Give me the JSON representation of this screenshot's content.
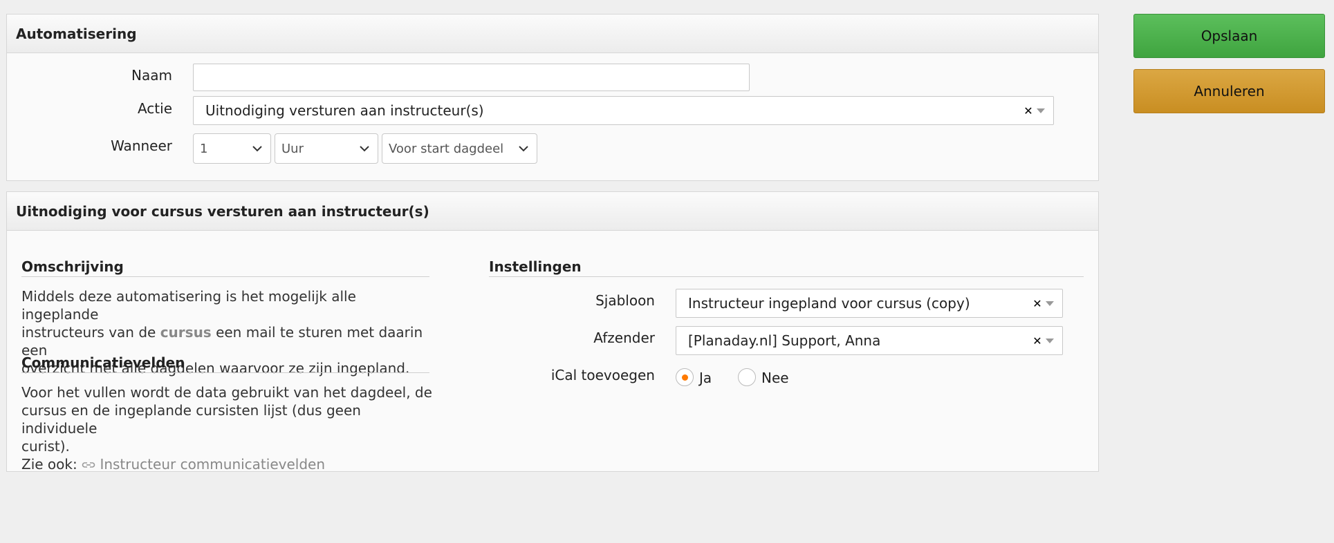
{
  "automation_panel": {
    "title": "Automatisering",
    "naam_label": "Naam",
    "naam_value": "",
    "actie_label": "Actie",
    "actie_value": "Uitnodiging versturen aan instructeur(s)",
    "wanneer_label": "Wanneer",
    "wanneer_amount": "1",
    "wanneer_unit": "Uur",
    "wanneer_relative": "Voor start dagdeel"
  },
  "detail_panel": {
    "title": "Uitnodiging voor cursus versturen aan instructeur(s)",
    "omschrijving": {
      "title": "Omschrijving",
      "line1": "Middels deze automatisering is het mogelijk alle ingeplande",
      "line2_pre": "instructeurs van de ",
      "line2_highlight": "cursus",
      "line2_post": " een mail te sturen met daarin een",
      "line3": "overzicht met alle dagdelen waarvoor ze zijn ingepland."
    },
    "communicatievelden": {
      "title": "Communicatievelden",
      "line1": "Voor het vullen wordt de data gebruikt van het dagdeel, de",
      "line2": "cursus en de ingeplande cursisten lijst (dus geen individuele",
      "line3": "curist).",
      "see_also_label": "Zie ook:",
      "see_also_link": "Instructeur communicatievelden"
    },
    "instellingen": {
      "title": "Instellingen",
      "sjabloon_label": "Sjabloon",
      "sjabloon_value": "Instructeur ingepland voor cursus (copy)",
      "afzender_label": "Afzender",
      "afzender_value": "[Planaday.nl] Support, Anna",
      "ical_label": "iCal toevoegen",
      "ical_options": [
        "Ja",
        "Nee"
      ],
      "ical_selected": "Ja"
    }
  },
  "actions": {
    "save_label": "Opslaan",
    "cancel_label": "Annuleren"
  },
  "colors": {
    "save": "#4cb34c",
    "cancel": "#d39b33",
    "radio_selected": "#ff7a00"
  }
}
